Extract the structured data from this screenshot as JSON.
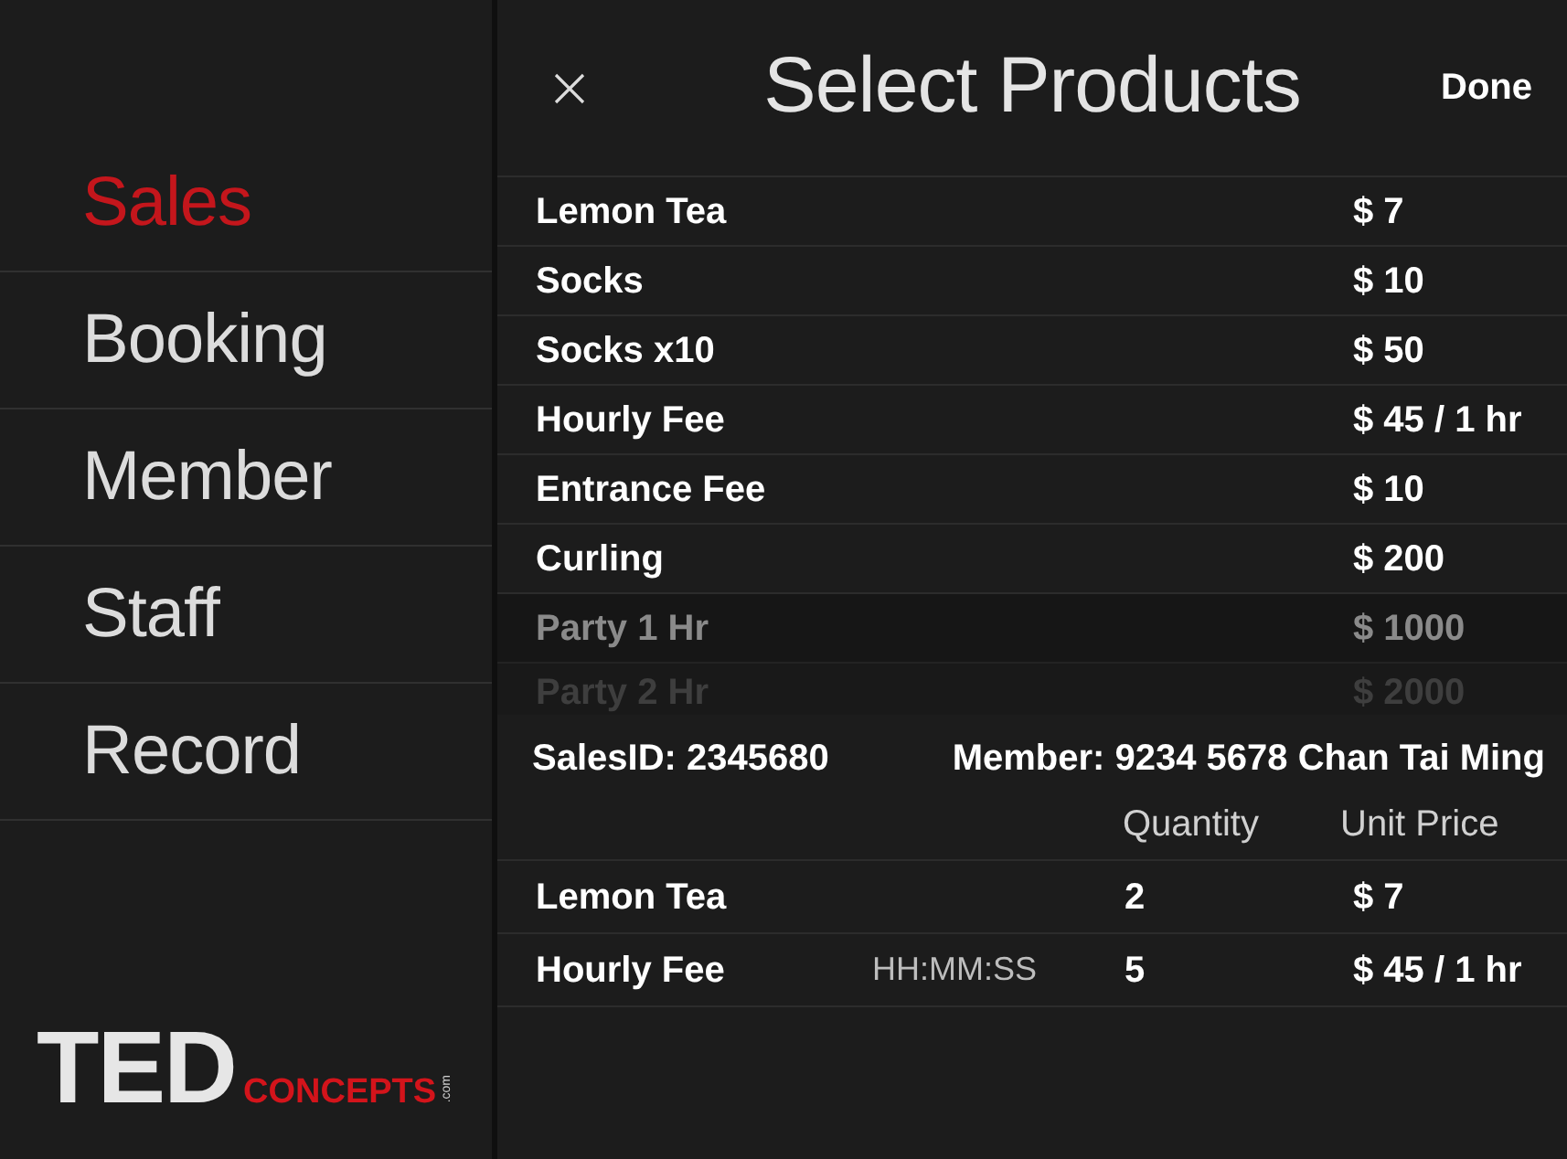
{
  "sidebar": {
    "items": [
      {
        "label": "Sales",
        "selected": true
      },
      {
        "label": "Booking",
        "selected": false
      },
      {
        "label": "Member",
        "selected": false
      },
      {
        "label": "Staff",
        "selected": false
      },
      {
        "label": "Record",
        "selected": false
      }
    ]
  },
  "logo": {
    "primary": "TED",
    "secondary": "CONCEPTS",
    "suffix": ".com"
  },
  "header": {
    "title": "Select Products",
    "done_button": "Done"
  },
  "products": [
    {
      "name": "Lemon Tea",
      "price": "$ 7"
    },
    {
      "name": "Socks",
      "price": "$ 10"
    },
    {
      "name": "Socks x10",
      "price": "$ 50"
    },
    {
      "name": "Hourly Fee",
      "price": "$ 45 / 1 hr"
    },
    {
      "name": "Entrance Fee",
      "price": "$ 10"
    },
    {
      "name": "Curling",
      "price": "$ 200"
    },
    {
      "name": "Party 1 Hr",
      "price": "$ 1000"
    },
    {
      "name": "Party 2 Hr",
      "price": "$ 2000"
    }
  ],
  "order": {
    "sales_id": "SalesID: 2345680",
    "member": "Member: 9234 5678 Chan Tai Ming",
    "columns": [
      "Quantity",
      "Unit Price"
    ],
    "rows": [
      {
        "name": "Lemon Tea",
        "quantity": "2",
        "unit_price": "$ 7"
      },
      {
        "name": "Hourly Fee",
        "timer": "HH:MM:SS",
        "quantity": "5",
        "unit_price": "$ 45 / 1 hr"
      }
    ]
  }
}
